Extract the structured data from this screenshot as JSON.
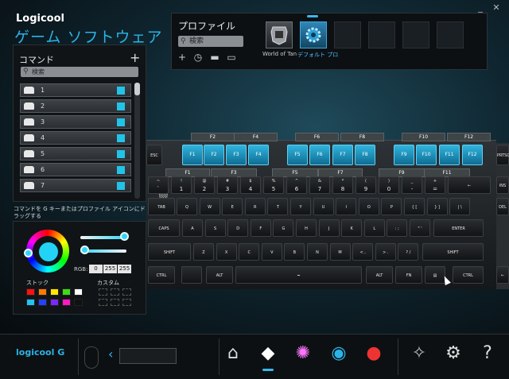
{
  "header": {
    "brand": "Logicool",
    "title": "ゲーム ソフトウェア"
  },
  "window": {
    "minimize": "_",
    "close": "✕"
  },
  "profiles": {
    "title": "プロファイル",
    "search_placeholder": "検索",
    "slots": [
      {
        "label": "World of Tan",
        "icon": "tank-game-icon"
      },
      {
        "label": "デフォルト プロ",
        "icon": "gear-profile-icon",
        "selected": true
      }
    ]
  },
  "commands": {
    "title": "コマンド",
    "add": "+",
    "search_placeholder": "検索",
    "items": [
      "1",
      "2",
      "3",
      "4",
      "5",
      "6",
      "7"
    ],
    "accent": "#22c3e8"
  },
  "hint": "コマンドを G キーまたはプロファイル アイコンにドラッグする",
  "color": {
    "rgb_label": "RGB:",
    "r": "0",
    "g": "255",
    "b": "255",
    "stock_label": "ストック",
    "custom_label": "カスタム",
    "stock_colors": [
      "#ff1010",
      "#ff7a00",
      "#ffe600",
      "#3cdc16",
      "#ffffff",
      "#23c4f2",
      "#2242ff",
      "#7a28ff",
      "#ff18c8",
      "#111111"
    ],
    "selected": "#22d3f5"
  },
  "keyboard": {
    "gkeys": [
      "F1",
      "F2",
      "F3",
      "F4",
      "F5",
      "F6",
      "F7",
      "F8",
      "F9",
      "F10",
      "F11",
      "F12"
    ],
    "labels_top": [
      "F2",
      "F4",
      "F6",
      "F8",
      "F10",
      "F12"
    ],
    "labels_bottom": [
      "F1",
      "F3",
      "F5",
      "F7",
      "F9",
      "F11"
    ],
    "esc": "ESC",
    "prtsc": "PRTSC",
    "num_row": [
      [
        "~",
        "`"
      ],
      [
        "!",
        "1"
      ],
      [
        "@",
        "2"
      ],
      [
        "#",
        "3"
      ],
      [
        "$",
        "4"
      ],
      [
        "%",
        "5"
      ],
      [
        "^",
        "6"
      ],
      [
        "&",
        "7"
      ],
      [
        "*",
        "8"
      ],
      [
        "(",
        "9"
      ],
      [
        ")",
        "0"
      ],
      [
        "_",
        "-"
      ],
      [
        "+",
        "="
      ]
    ],
    "backspace": "←",
    "tab": "TAB",
    "qrow": [
      "Q",
      "W",
      "E",
      "R",
      "T",
      "Y",
      "U",
      "I",
      "O",
      "P",
      "{ [",
      "} ]",
      "| \\"
    ],
    "caps": "CAPS",
    "arow": [
      "A",
      "S",
      "D",
      "F",
      "G",
      "H",
      "J",
      "K",
      "L",
      ": ;",
      "\" '"
    ],
    "enter": "ENTER",
    "lshift": "SHIFT",
    "zrow": [
      "Z",
      "X",
      "C",
      "V",
      "B",
      "N",
      "M",
      "< ,",
      "> .",
      "? /"
    ],
    "rshift": "SHIFT",
    "ctrl": "CTRL",
    "alt": "ALT",
    "space": "━",
    "altgr": "ALT",
    "fn": "FN",
    "menu": "▤",
    "rctrl": "CTRL",
    "ins": "INS",
    "del": "DEL",
    "arrow_left": "←"
  },
  "footer": {
    "logo": "logicool",
    "logo_mark": "G",
    "nav": [
      "home-icon",
      "g-key-icon",
      "lighting-icon",
      "keypress-icon",
      "heatmap-icon"
    ],
    "settings": [
      "share-icon",
      "gear-icon",
      "help-icon"
    ]
  }
}
